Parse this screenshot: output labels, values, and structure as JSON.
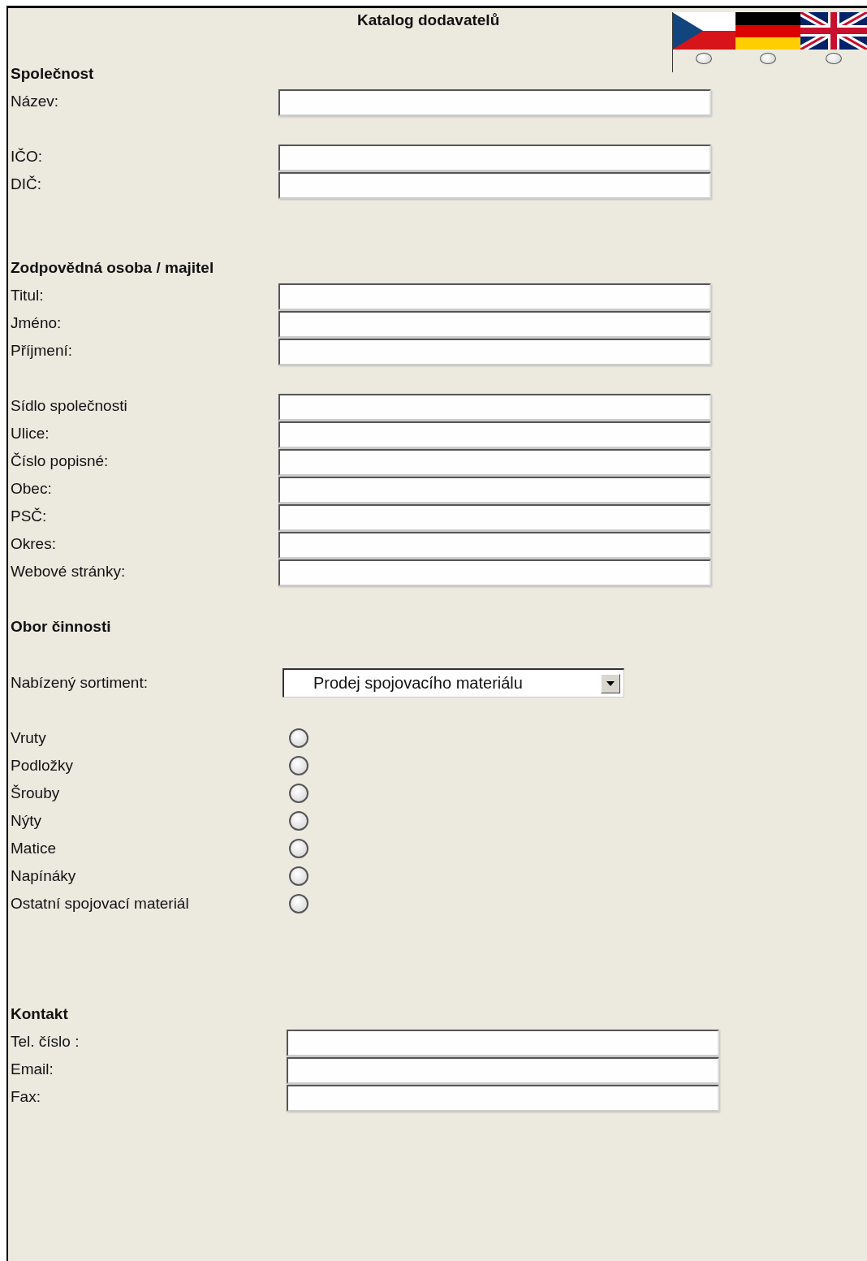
{
  "title": "Katalog dodavatelů",
  "language_options": [
    {
      "kind": "cz",
      "selected": false
    },
    {
      "kind": "de",
      "selected": false
    },
    {
      "kind": "gb",
      "selected": false
    }
  ],
  "groups": [
    {
      "rows": [
        {
          "kind": "heading",
          "label": "Společnost"
        },
        {
          "kind": "field",
          "label": "Název:"
        }
      ]
    },
    {
      "rows": [
        {
          "kind": "field",
          "label": "IČO:"
        },
        {
          "kind": "field",
          "label": "DIČ:"
        }
      ]
    },
    {
      "rows": [
        {
          "kind": "heading",
          "label": "Zodpovědná osoba / majitel"
        },
        {
          "kind": "field",
          "label": "Titul:"
        },
        {
          "kind": "field",
          "label": "Jméno:"
        },
        {
          "kind": "field",
          "label": "Příjmení:"
        }
      ]
    },
    {
      "rows": [
        {
          "kind": "field",
          "label": "Sídlo společnosti"
        },
        {
          "kind": "field",
          "label": "Ulice:"
        },
        {
          "kind": "field",
          "label": "Číslo popisné:"
        },
        {
          "kind": "field",
          "label": "Obec:"
        },
        {
          "kind": "field",
          "label": "PSČ:"
        },
        {
          "kind": "field",
          "label": "Okres:"
        },
        {
          "kind": "field",
          "label": "Webové stránky:"
        }
      ]
    },
    {
      "rows": [
        {
          "kind": "heading",
          "label": "Obor činnosti"
        }
      ]
    },
    {
      "rows": [
        {
          "kind": "select",
          "label": "Nabízený sortiment:",
          "value": "Prodej spojovacího materiálu"
        }
      ]
    },
    {
      "rows": [
        {
          "kind": "radio",
          "label": "Vruty",
          "selected": false
        },
        {
          "kind": "radio",
          "label": "Podložky",
          "selected": false
        },
        {
          "kind": "radio",
          "label": "Šrouby",
          "selected": false
        },
        {
          "kind": "radio",
          "label": "Nýty",
          "selected": false
        },
        {
          "kind": "radio",
          "label": "Matice",
          "selected": false
        },
        {
          "kind": "radio",
          "label": "Napínáky",
          "selected": false
        },
        {
          "kind": "radio",
          "label": "Ostatní spojovací materiál",
          "selected": false
        }
      ]
    },
    {
      "rows": [
        {
          "kind": "heading",
          "label": "Kontakt"
        },
        {
          "kind": "field",
          "label": "Tel. číslo :"
        },
        {
          "kind": "field",
          "label": "Email:"
        },
        {
          "kind": "field",
          "label": "Fax:"
        }
      ]
    }
  ]
}
